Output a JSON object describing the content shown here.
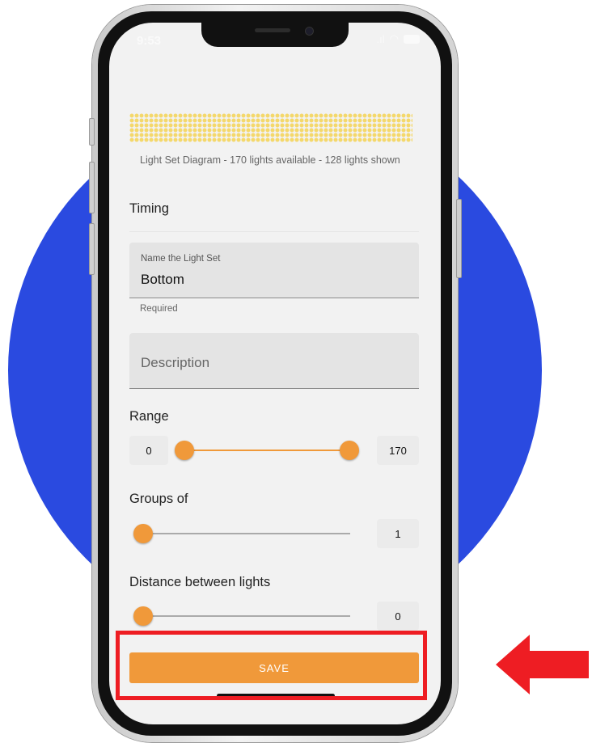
{
  "status_bar": {
    "time": "9:53"
  },
  "diagram": {
    "caption": "Light Set Diagram - 170 lights available - 128 lights shown"
  },
  "timing": {
    "label": "Timing"
  },
  "name_field": {
    "label": "Name the Light Set",
    "value": "Bottom",
    "helper": "Required"
  },
  "description_field": {
    "placeholder": "Description"
  },
  "range": {
    "label": "Range",
    "min_value": "0",
    "max_value": "170",
    "low_fraction": 0,
    "high_fraction": 1
  },
  "groups": {
    "label": "Groups of",
    "value": "1",
    "fraction": 0
  },
  "distance": {
    "label": "Distance between lights",
    "value": "0",
    "fraction": 0
  },
  "save_button": {
    "label": "SAVE"
  },
  "colors": {
    "accent": "#f0993a",
    "background_circle": "#2a4ae0",
    "highlight": "#ee1d23"
  }
}
